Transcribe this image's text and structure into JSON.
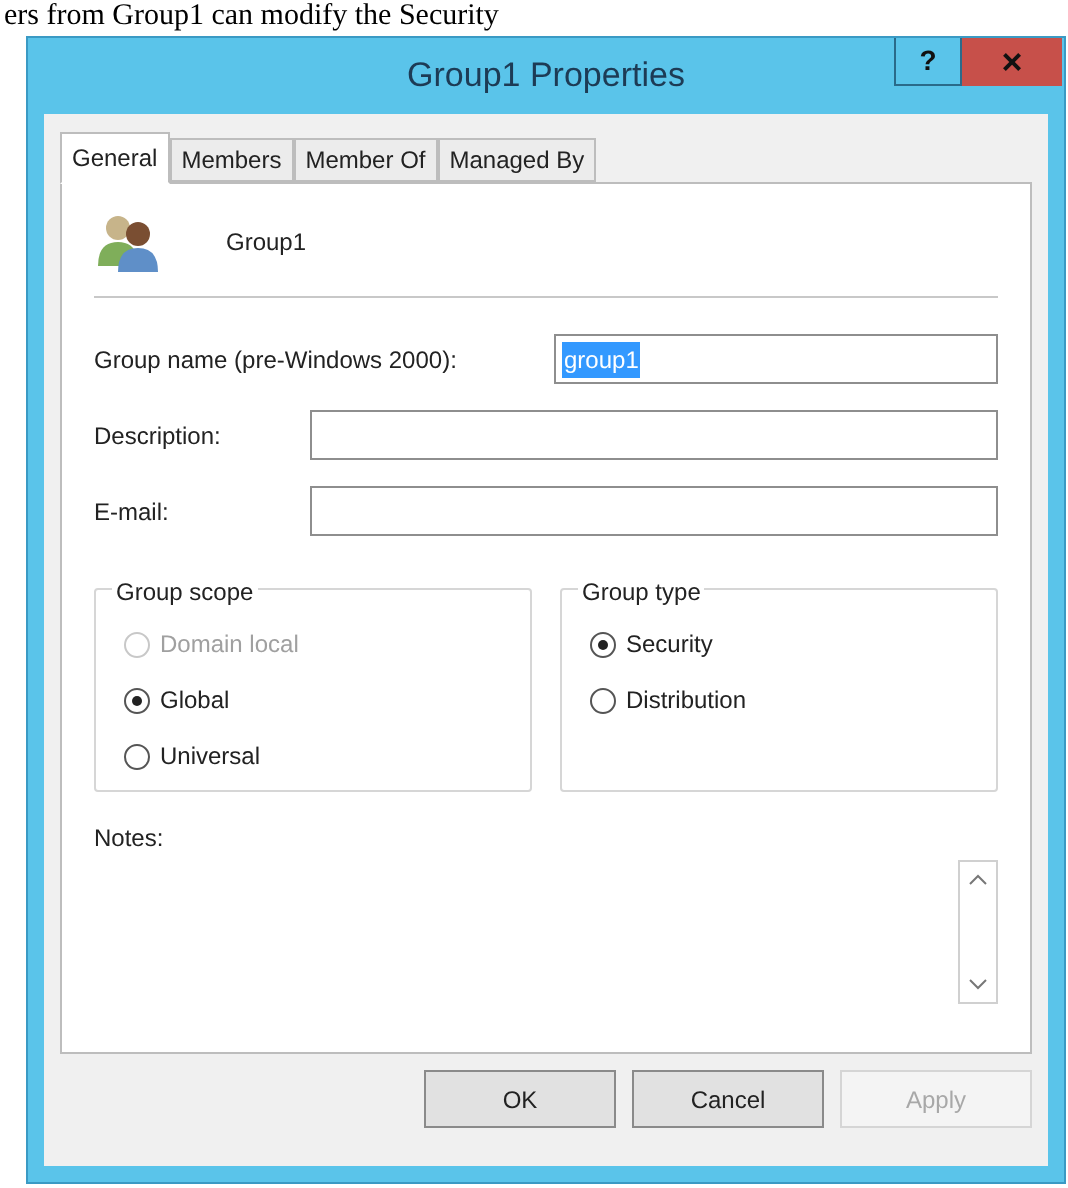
{
  "page_text": "ers from Group1 can modify the Security",
  "window": {
    "title": "Group1 Properties",
    "help": "?",
    "close": "×"
  },
  "tabs": [
    {
      "label": "General",
      "selected": true
    },
    {
      "label": "Members",
      "selected": false
    },
    {
      "label": "Member Of",
      "selected": false
    },
    {
      "label": "Managed By",
      "selected": false
    }
  ],
  "header": {
    "name": "Group1"
  },
  "fields": [
    {
      "label": "Group name (pre-Windows 2000):",
      "value": "group1",
      "highlighted": true
    },
    {
      "label": "Description:"
    },
    {
      "label": "E-mail:"
    }
  ],
  "group_scope": {
    "title": "Group scope",
    "options": [
      {
        "label": "Domain local",
        "selected": false,
        "disabled": true
      },
      {
        "label": "Global",
        "selected": true,
        "disabled": false
      },
      {
        "label": "Universal",
        "selected": false,
        "disabled": false
      }
    ]
  },
  "group_type": {
    "title": "Group type",
    "options": [
      {
        "label": "Security",
        "selected": true,
        "disabled": false
      },
      {
        "label": "Distribution",
        "selected": false,
        "disabled": false
      }
    ]
  },
  "notes": {
    "label": "Notes:"
  },
  "buttons": [
    {
      "label": "OK",
      "disabled": false
    },
    {
      "label": "Cancel",
      "disabled": false
    },
    {
      "label": "Apply",
      "disabled": true
    }
  ]
}
